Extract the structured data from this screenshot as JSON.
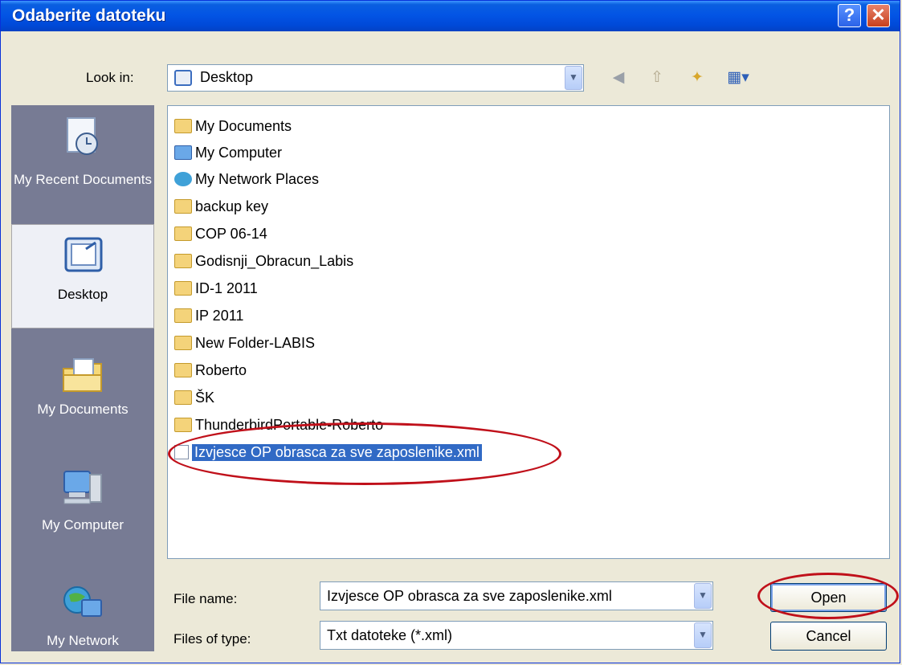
{
  "window": {
    "title": "Odaberite datoteku",
    "help_glyph": "?",
    "close_glyph": "✕"
  },
  "lookin": {
    "label": "Look in:",
    "value": "Desktop"
  },
  "places": [
    {
      "label": "My Recent Documents"
    },
    {
      "label": "Desktop"
    },
    {
      "label": "My Documents"
    },
    {
      "label": "My Computer"
    },
    {
      "label": "My Network"
    }
  ],
  "files": [
    {
      "name": "My Documents",
      "icon": "my-documents-icon"
    },
    {
      "name": "My Computer",
      "icon": "my-computer-icon"
    },
    {
      "name": "My Network Places",
      "icon": "network-places-icon"
    },
    {
      "name": "backup key",
      "icon": "folder-icon"
    },
    {
      "name": "COP 06-14",
      "icon": "folder-icon"
    },
    {
      "name": "Godisnji_Obracun_Labis",
      "icon": "folder-icon"
    },
    {
      "name": "ID-1 2011",
      "icon": "folder-icon"
    },
    {
      "name": "IP 2011",
      "icon": "folder-icon"
    },
    {
      "name": "New Folder-LABIS",
      "icon": "folder-icon"
    },
    {
      "name": "Roberto",
      "icon": "folder-icon"
    },
    {
      "name": "ŠK",
      "icon": "folder-icon"
    },
    {
      "name": "ThunderbirdPortable-Roberto",
      "icon": "folder-icon"
    },
    {
      "name": "Izvjesce OP obrasca za sve zaposlenike.xml",
      "icon": "xml-file-icon",
      "selected": true
    }
  ],
  "filename": {
    "label": "File name:",
    "value": "Izvjesce OP obrasca za sve zaposlenike.xml"
  },
  "filetype": {
    "label": "Files of type:",
    "value": "Txt datoteke (*.xml)"
  },
  "buttons": {
    "open": "Open",
    "cancel": "Cancel"
  },
  "colors": {
    "title_bar": "#0355e5",
    "places_bg": "#777b94",
    "selection": "#316ac5",
    "annotation": "#c0101a"
  }
}
